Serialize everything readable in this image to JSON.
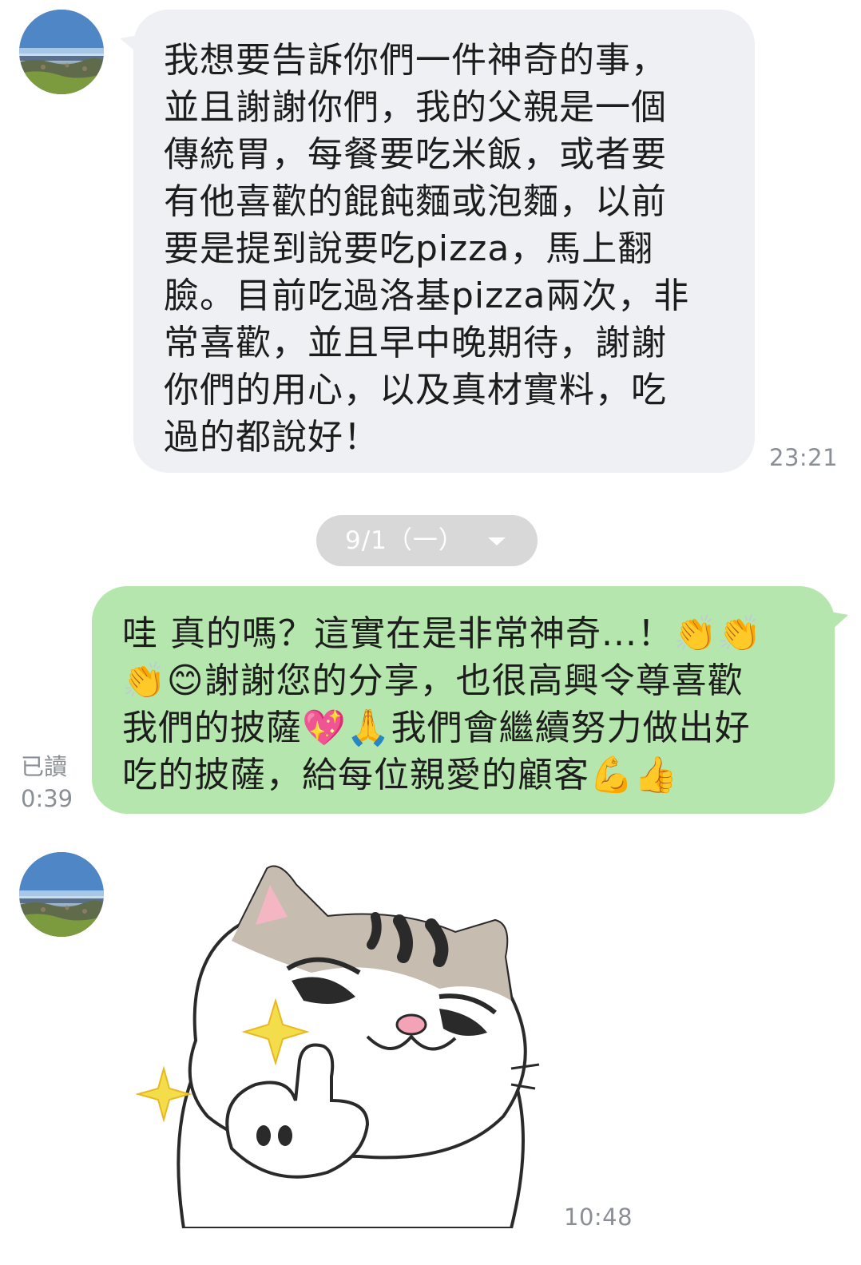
{
  "conversation": {
    "incoming_message": {
      "lines": [
        "我想要告訴你們一件神奇的事，",
        "並且謝謝你們，我的父親是一個",
        "傳統胃，每餐要吃米飯，或者要",
        "有他喜歡的餛飩麵或泡麵，以前",
        "要是提到說要吃pizza，馬上翻",
        "臉。目前吃過洛基pizza兩次，非",
        "常喜歡，並且早中晚期待，謝謝",
        "你們的用心，以及真材實料，吃",
        "過的都說好！"
      ],
      "time": "23:21"
    },
    "date_divider": {
      "label": "9/1（一）",
      "icon": "chevron-down-icon"
    },
    "outgoing_message": {
      "lines": [
        "哇 真的嗎？這實在是非常神奇...！👏👏",
        "👏😊謝謝您的分享，也很高興令尊喜歡",
        "我們的披薩💖🙏我們會繼續努力做出好",
        "吃的披薩，給每位親愛的顧客💪👍"
      ],
      "read_status": "已讀",
      "time": "0:39"
    },
    "sticker_message": {
      "sticker": "cat-thumbs-up-sticker",
      "time": "10:48"
    }
  },
  "colors": {
    "incoming_bubble": "#eef0f3",
    "outgoing_bubble": "#b5e6ad",
    "timestamp": "#8a8f96",
    "date_pill": "#d8d8d8"
  }
}
